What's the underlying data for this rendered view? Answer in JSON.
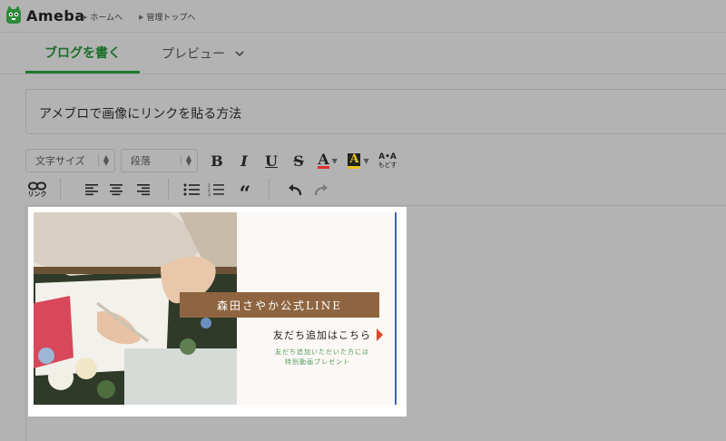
{
  "header": {
    "logo_text": "Ameba",
    "breadcrumbs": [
      {
        "label": "ホームへ"
      },
      {
        "label": "管理トップへ"
      }
    ]
  },
  "tabs": {
    "write": "ブログを書く",
    "preview": "プレビュー"
  },
  "post": {
    "title": "アメブロで画像にリンクを貼る方法"
  },
  "toolbar": {
    "font_size_select": "文字サイズ",
    "paragraph_select": "段落",
    "bold": "B",
    "italic": "I",
    "underline": "U",
    "strike": "S",
    "text_color": "A",
    "bg_color": "A",
    "reset_top": "A•A",
    "reset_label": "もどす",
    "link_label": "リンク",
    "quote": "“",
    "icons": [
      "link-icon",
      "align-left-icon",
      "align-center-icon",
      "align-right-icon",
      "bullet-list-icon",
      "numbered-list-icon",
      "quote-icon",
      "undo-icon",
      "redo-icon"
    ]
  },
  "banner": {
    "name": "森田さやか公式LINE",
    "add_friend": "友だち追加はこちら",
    "gift_line1": "友だち追加いただいた方には",
    "gift_line2": "特別動画プレゼント"
  },
  "colors": {
    "accent_green": "#1f7a2f",
    "banner_brown": "#8e6540",
    "arrow_red": "#e0452a",
    "gift_green": "#4f9a55",
    "text_color_underline": "#e03030",
    "bg_color_swatch": "#e8c21a"
  }
}
